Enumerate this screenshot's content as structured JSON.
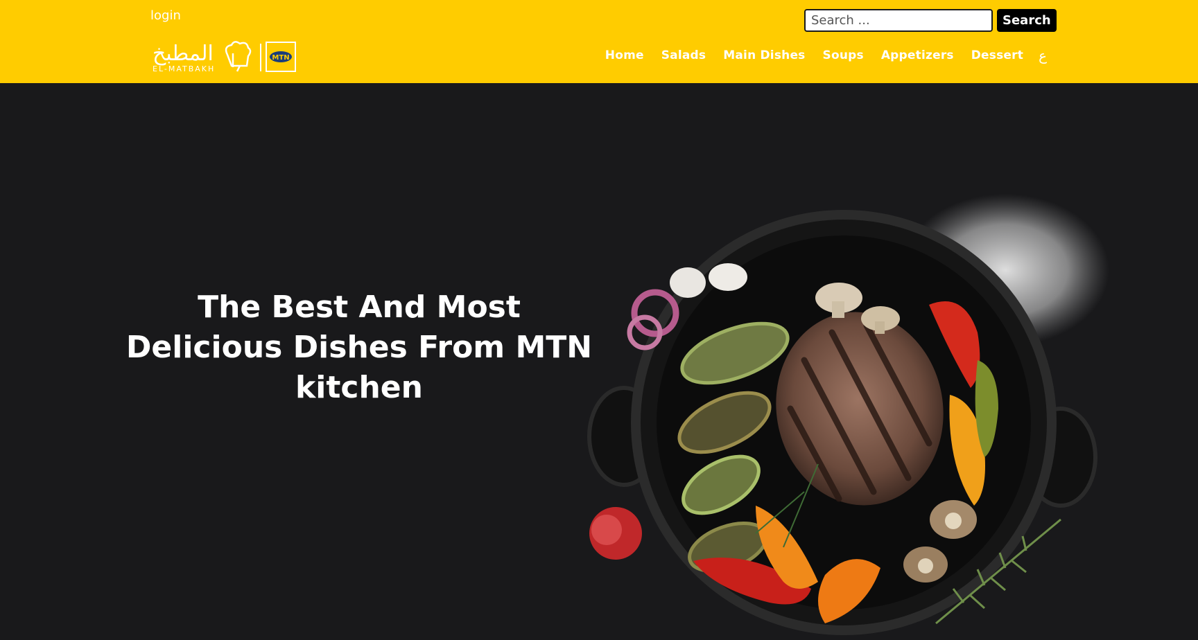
{
  "header": {
    "login_label": "login",
    "search": {
      "placeholder": "Search ...",
      "button_label": "Search"
    },
    "logo": {
      "brand_arabic": "المطبخ",
      "brand_latin": "EL-MATBAKH",
      "partner": "MTN"
    },
    "nav": {
      "items": [
        {
          "label": "Home"
        },
        {
          "label": "Salads"
        },
        {
          "label": "Main Dishes"
        },
        {
          "label": "Soups"
        },
        {
          "label": "Appetizers"
        },
        {
          "label": "Dessert"
        }
      ],
      "language_toggle": "ع"
    }
  },
  "hero": {
    "title_lines": [
      "The Best And Most",
      "Delicious Dishes From MTN",
      "kitchen"
    ]
  },
  "colors": {
    "brand_yellow": "#ffcc00",
    "hero_bg": "#19191b"
  }
}
